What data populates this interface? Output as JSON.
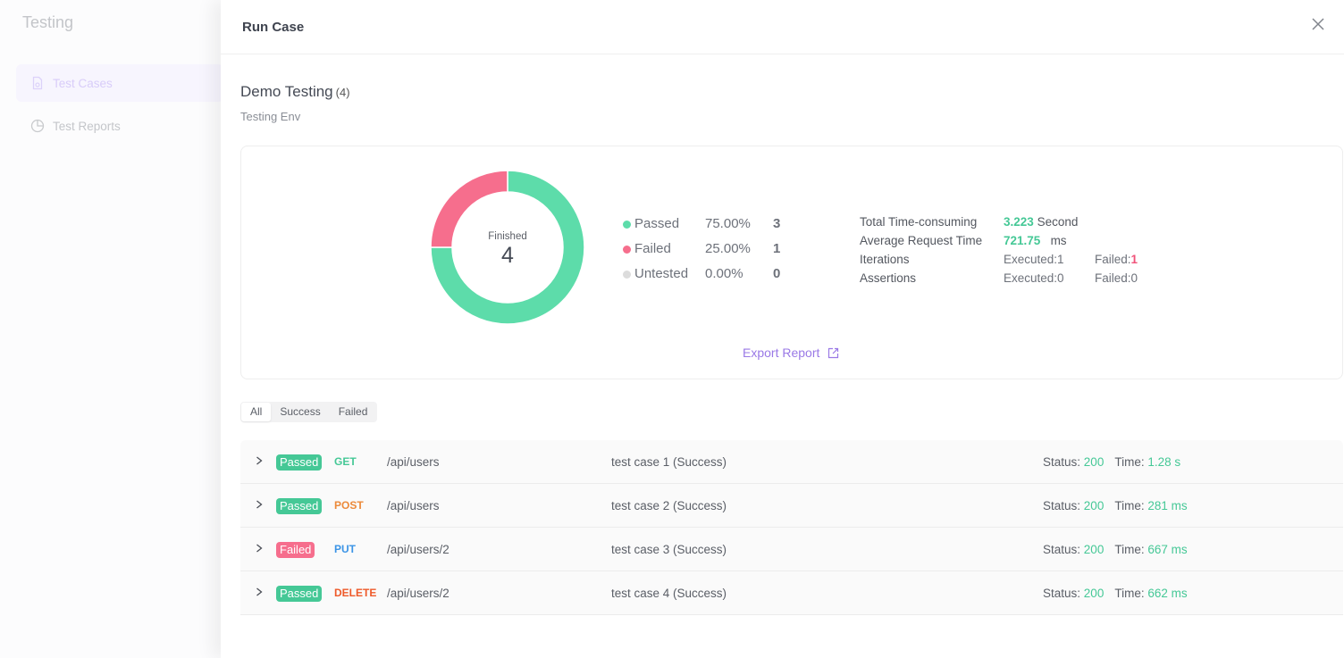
{
  "background": {
    "app_title": "Testing",
    "sidebar": {
      "items": [
        {
          "label": "Test Cases",
          "icon": "file-icon",
          "active": true
        },
        {
          "label": "Test Reports",
          "icon": "pie-chart-icon",
          "active": false
        }
      ]
    }
  },
  "drawer": {
    "title": "Run Case",
    "close_icon": "close-icon"
  },
  "suite": {
    "name": "Demo Testing",
    "count": "(4)",
    "environment": "Testing Env"
  },
  "summary": {
    "donut": {
      "center_label": "Finished",
      "center_value": "4"
    },
    "legend": [
      {
        "label": "Passed",
        "percent": "75.00%",
        "count": "3",
        "color": "#5ddcaa"
      },
      {
        "label": "Failed",
        "percent": "25.00%",
        "count": "1",
        "color": "#f66e8d"
      },
      {
        "label": "Untested",
        "percent": "0.00%",
        "count": "0",
        "color": "#dcdcdc"
      }
    ],
    "stats": {
      "total_time": {
        "label": "Total Time-consuming",
        "value": "3.223",
        "unit": "Second"
      },
      "avg_time": {
        "label": "Average Request Time",
        "value": "721.75",
        "unit": "ms"
      },
      "iterations": {
        "label": "Iterations",
        "executed_label": "Executed:",
        "executed": "1",
        "failed_label": "Failed:",
        "failed": "1"
      },
      "assertions": {
        "label": "Assertions",
        "executed_label": "Executed:",
        "executed": "0",
        "failed_label": "Failed:",
        "failed": "0"
      }
    },
    "export_label": "Export Report"
  },
  "filter": {
    "options": [
      "All",
      "Success",
      "Failed"
    ],
    "selected": "All"
  },
  "results": [
    {
      "result": "Passed",
      "method": "GET",
      "path": "/api/users",
      "name": "test case 1 (Success)",
      "status_label": "Status:",
      "status": "200",
      "time_label": "Time:",
      "time": "1.28 s"
    },
    {
      "result": "Passed",
      "method": "POST",
      "path": "/api/users",
      "name": "test case 2 (Success)",
      "status_label": "Status:",
      "status": "200",
      "time_label": "Time:",
      "time": "281 ms"
    },
    {
      "result": "Failed",
      "method": "PUT",
      "path": "/api/users/2",
      "name": "test case 3 (Success)",
      "status_label": "Status:",
      "status": "200",
      "time_label": "Time:",
      "time": "667 ms"
    },
    {
      "result": "Passed",
      "method": "DELETE",
      "path": "/api/users/2",
      "name": "test case 4 (Success)",
      "status_label": "Status:",
      "status": "200",
      "time_label": "Time:",
      "time": "662 ms"
    }
  ],
  "colors": {
    "passed": "#45c896",
    "failed": "#f0537a",
    "accent": "#9a79e6",
    "method_GET": "#45c896",
    "method_POST": "#ec8a3a",
    "method_PUT": "#3b94e6",
    "method_DELETE": "#ee5a2a"
  }
}
